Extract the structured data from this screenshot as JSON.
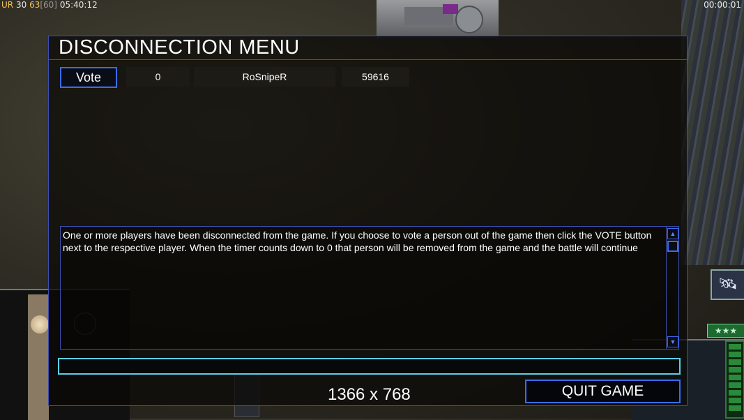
{
  "hud": {
    "top_left": {
      "tag": "UR",
      "a": "30",
      "b": "63",
      "c": "[60]",
      "time": "05:40:12"
    },
    "top_right_time": "00:00:01",
    "stars": "★★★"
  },
  "dialog": {
    "title": "DISCONNECTION MENU",
    "players": [
      {
        "vote_label": "Vote",
        "count": "0",
        "name": "RoSnipeR",
        "ping": "59616"
      }
    ],
    "message": "One or more players have been disconnected from the game. If you choose to vote a person out of the game then click the VOTE button next to the respective player. When the timer counts down to 0 that person will be removed from the game and the battle will continue",
    "chat_value": "",
    "quit_label": "QUIT GAME",
    "resolution": "1366 x 768"
  },
  "colors": {
    "dialog_border": "#3d4fb0",
    "button_border": "#3a6cf0",
    "input_border": "#5ad0e8"
  }
}
